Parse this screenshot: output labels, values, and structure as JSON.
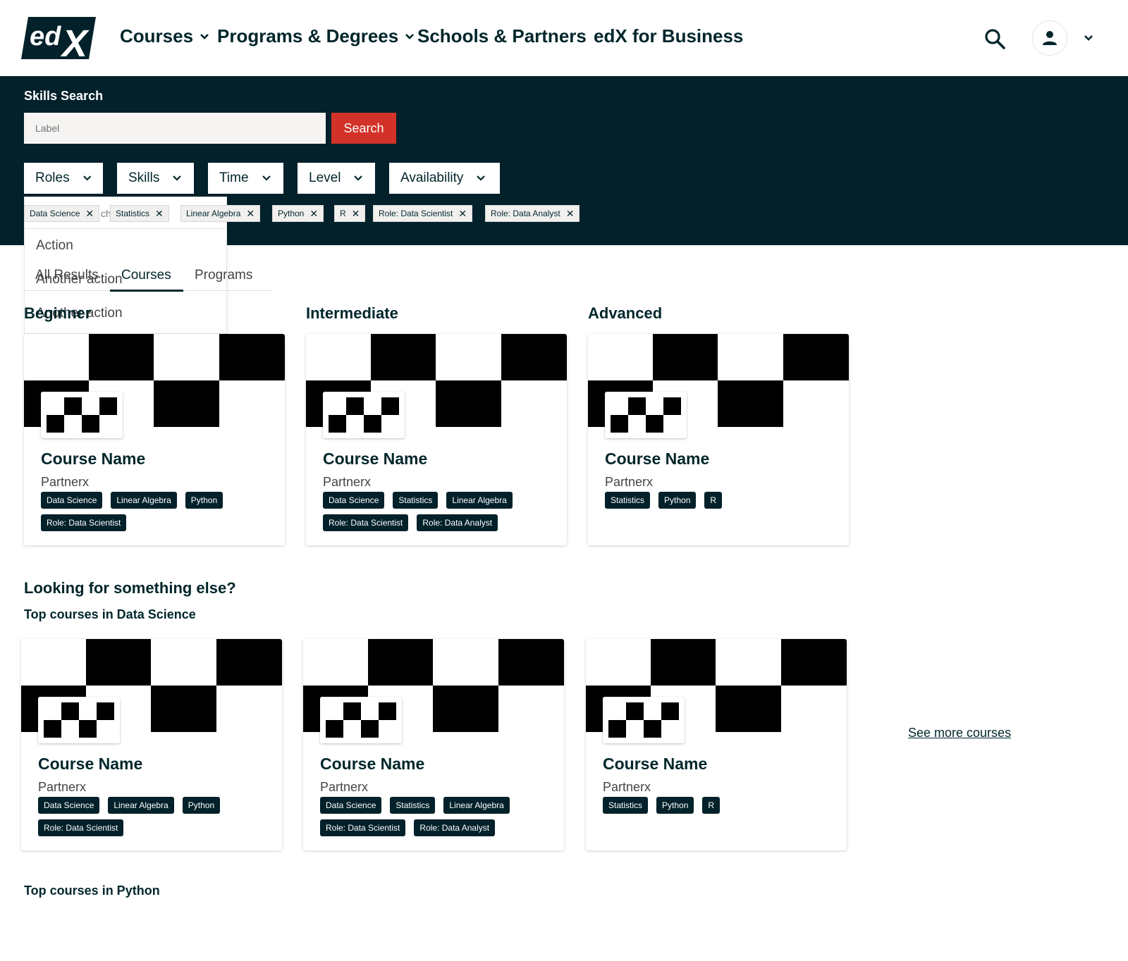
{
  "nav": {
    "courses": "Courses",
    "programs": "Programs & Degrees",
    "schools": "Schools & Partners",
    "business": "edX for Business"
  },
  "brand": {
    "dark": "#02212a",
    "accent": "#d23228"
  },
  "skills_search": {
    "title": "Skills Search",
    "input_placeholder": "Label",
    "search_button": "Search"
  },
  "filters": [
    "Roles",
    "Skills",
    "Time",
    "Level",
    "Availability"
  ],
  "active_chips": [
    "Data Science",
    "Statistics",
    "Linear Algebra",
    "Python",
    "R",
    "Role: Data Scientist",
    "Role: Data Analyst"
  ],
  "dropdown": {
    "search_ghost": "ch",
    "items": [
      "Action",
      "Another action",
      "Another action"
    ]
  },
  "tabs": [
    "All Results",
    "Courses",
    "Programs"
  ],
  "levels": [
    "Beginner",
    "Intermediate",
    "Advanced"
  ],
  "cards": [
    {
      "name": "Course Name",
      "partner": "Partnerx",
      "tags": [
        "Data Science",
        "Linear Algebra",
        "Python",
        "Role: Data Scientist"
      ]
    },
    {
      "name": "Course Name",
      "partner": "Partnerx",
      "tags": [
        "Data Science",
        "Statistics",
        "Linear Algebra",
        "Role: Data Scientist",
        "Role: Data Analyst"
      ]
    },
    {
      "name": "Course Name",
      "partner": "Partnerx",
      "tags": [
        "Statistics",
        "Python",
        "R"
      ]
    }
  ],
  "looking": {
    "title": "Looking for something else?",
    "top_data_science": "Top courses in Data Science",
    "top_python": "Top courses in Python",
    "see_more": "See more courses"
  },
  "top_cards": [
    {
      "name": "Course Name",
      "partner": "Partnerx",
      "tags": [
        "Data Science",
        "Linear Algebra",
        "Python",
        "Role: Data Scientist"
      ]
    },
    {
      "name": "Course Name",
      "partner": "Partnerx",
      "tags": [
        "Data Science",
        "Statistics",
        "Linear Algebra",
        "Role: Data Scientist",
        "Role: Data Analyst"
      ]
    },
    {
      "name": "Course Name",
      "partner": "Partnerx",
      "tags": [
        "Statistics",
        "Python",
        "R"
      ]
    }
  ]
}
